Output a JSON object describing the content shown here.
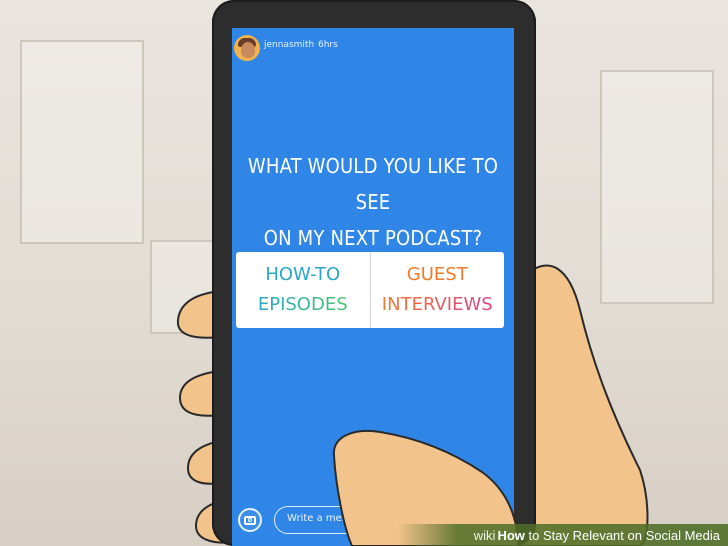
{
  "story": {
    "username": "jennasmith",
    "time": "6hrs",
    "question_line1": "WHAT WOULD YOU LIKE TO SEE",
    "question_line2": "ON MY NEXT PODCAST?",
    "poll": {
      "option1_line1": "HOW-TO",
      "option1_line2": "EPISODES",
      "option2_line1": "GUEST",
      "option2_line2": "INTERVIEWS"
    },
    "message_placeholder": "Write a message..."
  },
  "watermark": {
    "wiki": "wiki",
    "how": "How",
    "rest": " to Stay Relevant on Social Media"
  },
  "colors": {
    "screen_blue": "#2f86e6",
    "phone_body": "#2d2d2d",
    "poll_bg": "#ffffff",
    "option1_color": "#2aa7c9",
    "option1_gradient_end": "#49c56b",
    "option2_color": "#f07a2a",
    "option2_gradient_end": "#e0418b"
  },
  "icons": [
    "camera-icon",
    "avatar"
  ]
}
